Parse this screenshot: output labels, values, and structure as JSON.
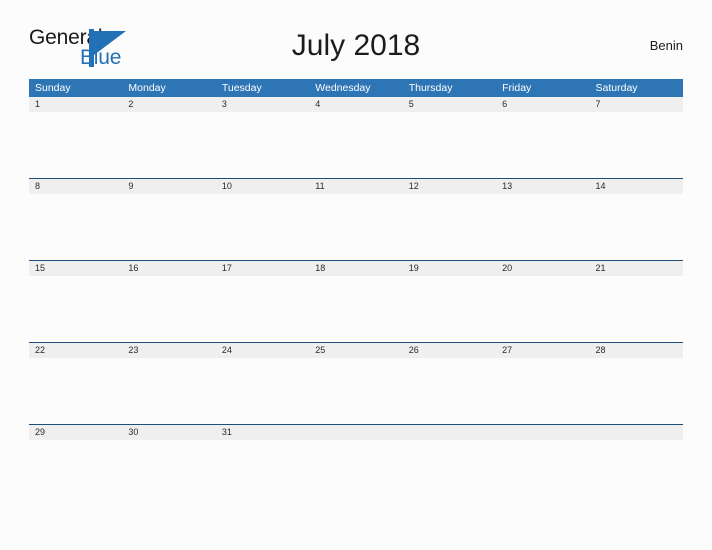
{
  "brand": {
    "name_primary": "General",
    "name_secondary": "Blue",
    "flag_color": "#2271b6"
  },
  "header": {
    "title": "July 2018",
    "region": "Benin"
  },
  "calendar": {
    "accent_color": "#2e75b6",
    "band_color": "#efefef",
    "separator_color": "#1f4e79",
    "weekdays": [
      "Sunday",
      "Monday",
      "Tuesday",
      "Wednesday",
      "Thursday",
      "Friday",
      "Saturday"
    ],
    "weeks": [
      [
        "1",
        "2",
        "3",
        "4",
        "5",
        "6",
        "7"
      ],
      [
        "8",
        "9",
        "10",
        "11",
        "12",
        "13",
        "14"
      ],
      [
        "15",
        "16",
        "17",
        "18",
        "19",
        "20",
        "21"
      ],
      [
        "22",
        "23",
        "24",
        "25",
        "26",
        "27",
        "28"
      ],
      [
        "29",
        "30",
        "31",
        "",
        "",
        "",
        ""
      ]
    ]
  }
}
